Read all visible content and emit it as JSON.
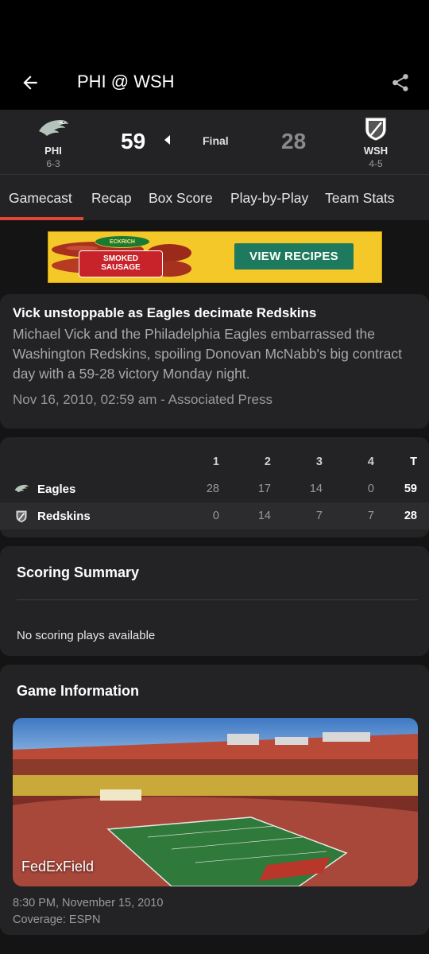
{
  "app_bar": {
    "title": "PHI @ WSH"
  },
  "game": {
    "home": {
      "abbr": "PHI",
      "record": "6-3",
      "score": "59",
      "logo": "eagles-logo-icon"
    },
    "away": {
      "abbr": "WSH",
      "record": "4-5",
      "score": "28",
      "logo": "redskins-logo-icon"
    },
    "status": "Final"
  },
  "tabs": [
    {
      "label": "Gamecast",
      "active": true
    },
    {
      "label": "Recap"
    },
    {
      "label": "Box Score"
    },
    {
      "label": "Play-by-Play"
    },
    {
      "label": "Team Stats"
    }
  ],
  "ad": {
    "brand": "ECKRICH",
    "product_line1": "SMOKED",
    "product_line2": "SAUSAGE",
    "cta": "VIEW RECIPES"
  },
  "news": {
    "headline": "Vick unstoppable as Eagles decimate Redskins",
    "summary": "Michael Vick and the Philadelphia Eagles embarrassed the Washington Redskins, spoiling Donovan McNabb's big contract day with a 59-28 victory Monday night.",
    "meta": "Nov 16, 2010, 02:59 am - Associated Press"
  },
  "linescore": {
    "headers": [
      "1",
      "2",
      "3",
      "4",
      "T"
    ],
    "rows": [
      {
        "team": "Eagles",
        "q": [
          "28",
          "17",
          "14",
          "0"
        ],
        "total": "59"
      },
      {
        "team": "Redskins",
        "q": [
          "0",
          "14",
          "7",
          "7"
        ],
        "total": "28"
      }
    ]
  },
  "scoring_summary": {
    "title": "Scoring Summary",
    "empty_text": "No scoring plays available"
  },
  "game_info": {
    "title": "Game Information",
    "venue": "FedExField",
    "datetime": "8:30 PM, November 15, 2010",
    "coverage": "Coverage: ESPN"
  },
  "colors": {
    "accent": "#e0473a",
    "card": "#232325",
    "background": "#141414"
  }
}
